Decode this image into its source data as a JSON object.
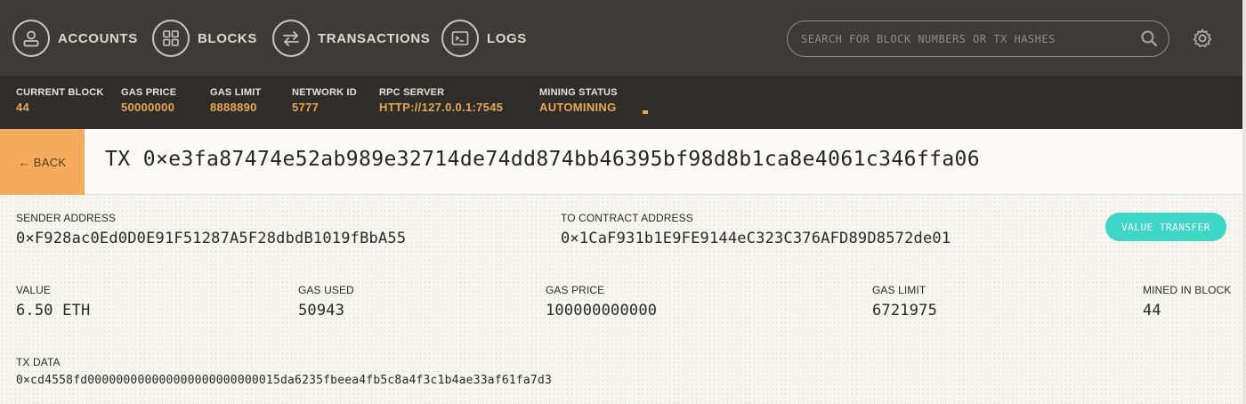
{
  "nav": {
    "items": [
      {
        "label": "ACCOUNTS",
        "icon": "account-icon"
      },
      {
        "label": "BLOCKS",
        "icon": "blocks-grid-icon"
      },
      {
        "label": "TRANSACTIONS",
        "icon": "transfer-arrows-icon"
      },
      {
        "label": "LOGS",
        "icon": "terminal-icon"
      }
    ],
    "search_placeholder": "SEARCH FOR BLOCK NUMBERS OR TX HASHES",
    "search_icon": "search-icon",
    "settings_icon": "gear-icon"
  },
  "status": {
    "current_block": {
      "label": "CURRENT BLOCK",
      "value": "44"
    },
    "gas_price": {
      "label": "GAS PRICE",
      "value": "50000000"
    },
    "gas_limit": {
      "label": "GAS LIMIT",
      "value": "8888890"
    },
    "network_id": {
      "label": "NETWORK ID",
      "value": "5777"
    },
    "rpc_server": {
      "label": "RPC SERVER",
      "value": "HTTP://127.0.0.1:7545"
    },
    "mining_status": {
      "label": "MINING STATUS",
      "value": "AUTOMINING"
    }
  },
  "header": {
    "back_label": "← BACK",
    "title": "TX 0×e3fa87474e52ab989e32714de74dd874bb46395bf98d8b1ca8e4061c346ffa06"
  },
  "tx": {
    "sender_label": "SENDER ADDRESS",
    "sender": "0×F928ac0Ed0D0E91F51287A5F28dbdB1019fBbA55",
    "to_label": "TO CONTRACT ADDRESS",
    "to": "0×1CaF931b1E9FE9144eC323C376AFD89D8572de01",
    "badge": "VALUE TRANSFER",
    "value_label": "VALUE",
    "value": "6.50 ETH",
    "gas_used_label": "GAS USED",
    "gas_used": "50943",
    "gas_price_label": "GAS PRICE",
    "gas_price": "100000000000",
    "gas_limit_label": "GAS LIMIT",
    "gas_limit": "6721975",
    "mined_label": "MINED IN BLOCK",
    "mined_block": "44",
    "data_label": "TX DATA",
    "data": "0×cd4558fd000000000000000000000000015da6235fbeea4fb5c8a4f3c1b4ae33af61fa7d3"
  },
  "colors": {
    "nav_bg": "#3d3b38",
    "status_bg": "#2f2d2a",
    "accent": "#e8a853",
    "back_bg": "#f4ac5c",
    "badge_bg": "#3ed6c7"
  }
}
